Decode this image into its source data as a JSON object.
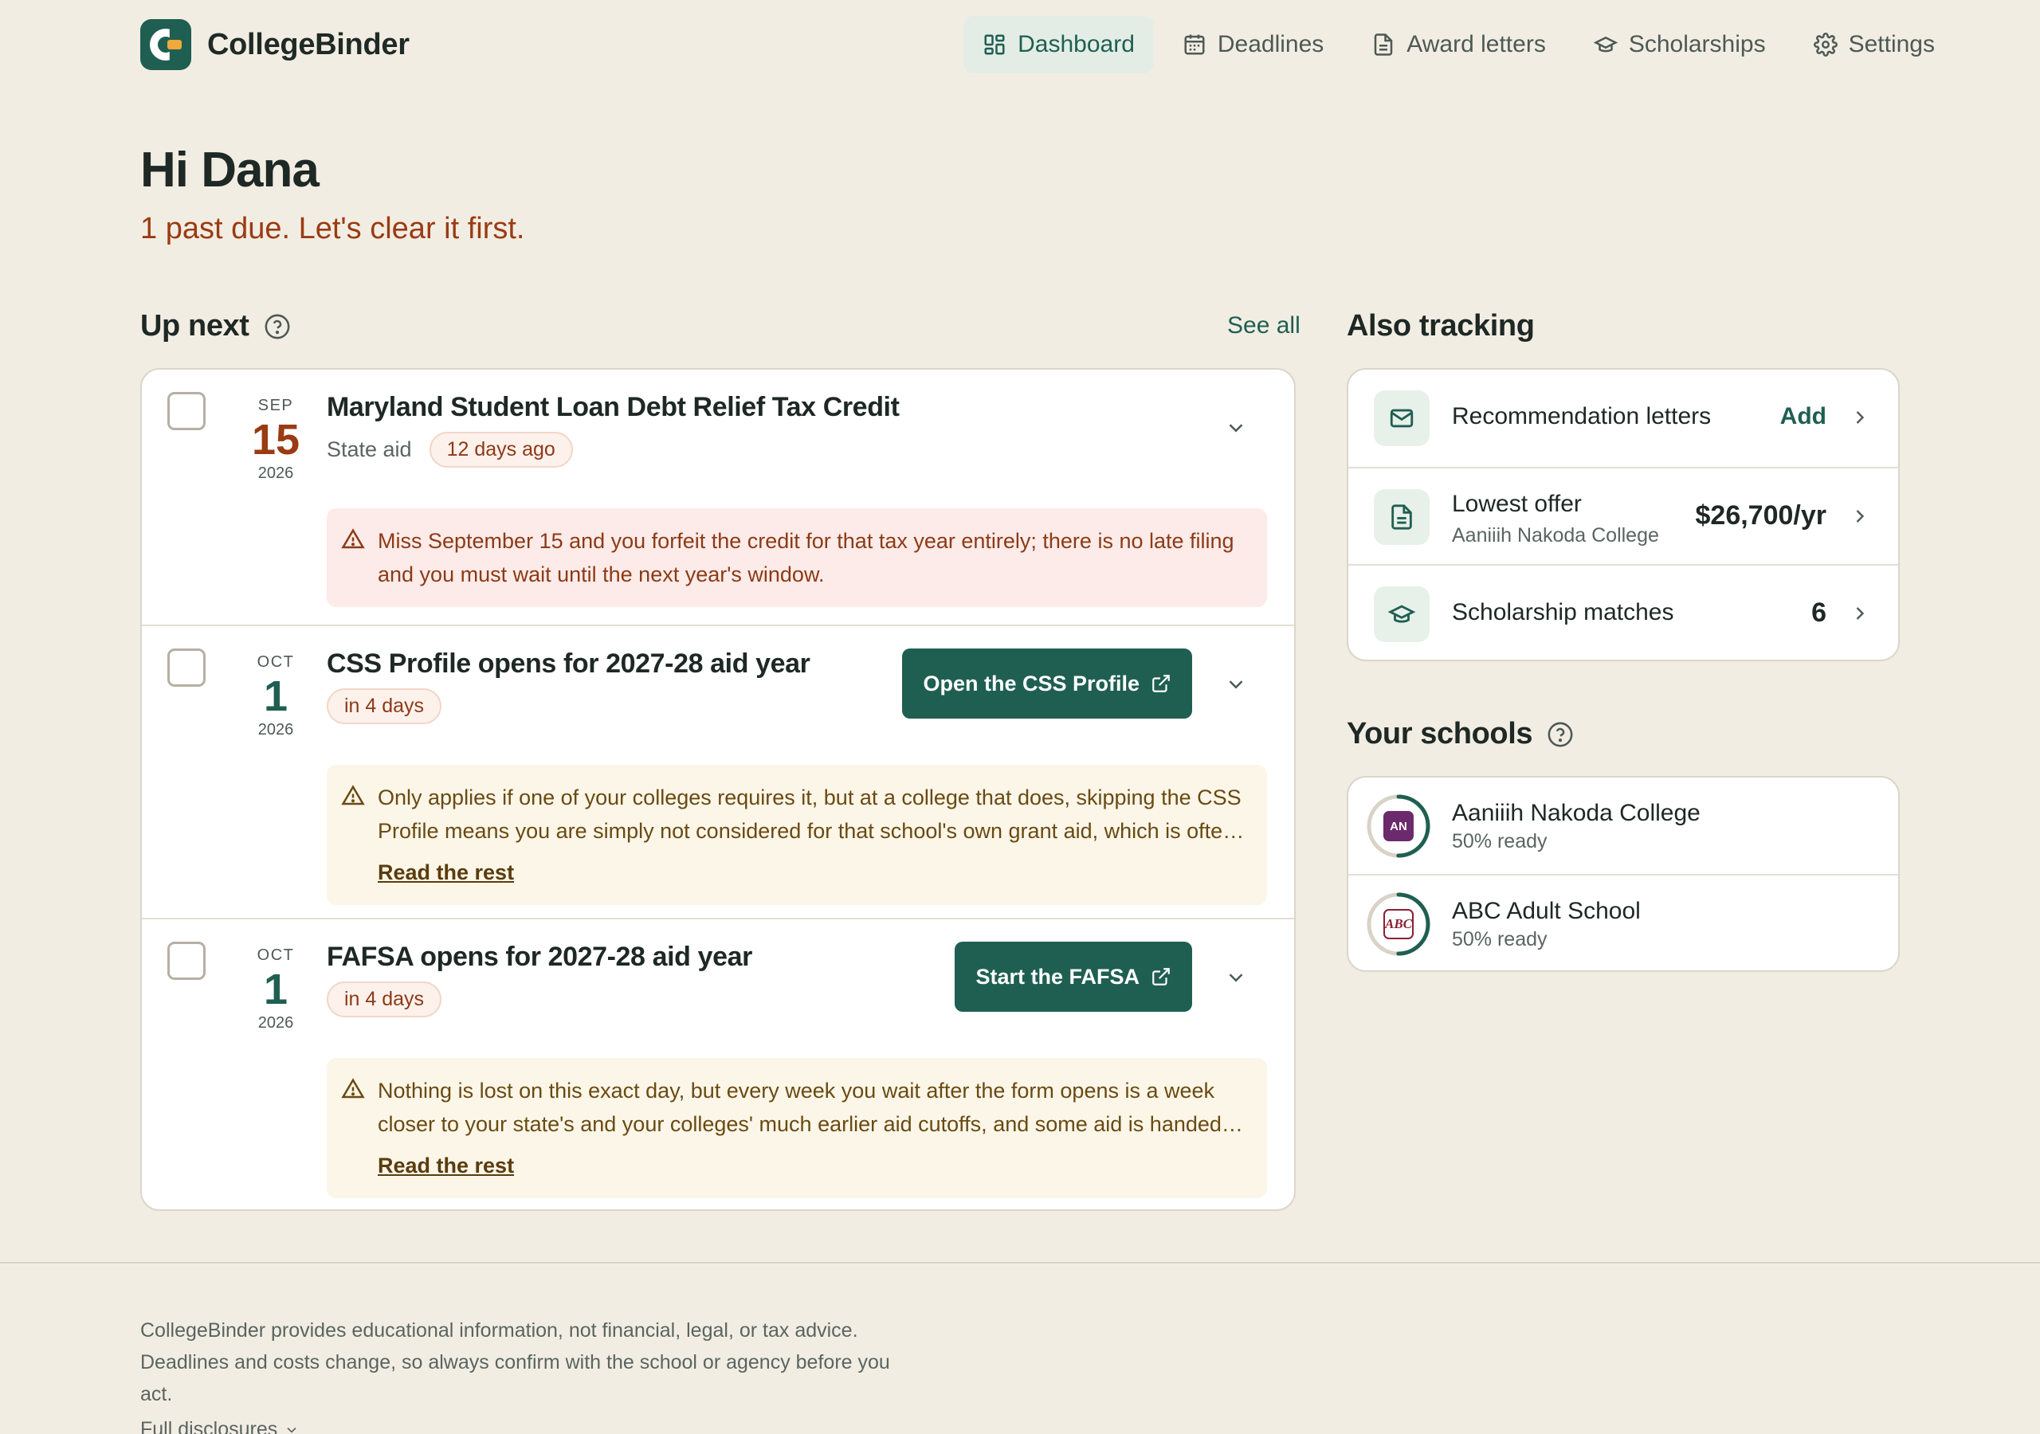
{
  "app": {
    "name": "CollegeBinder"
  },
  "nav": {
    "items": [
      {
        "label": "Dashboard",
        "icon": "dashboard-icon",
        "active": true
      },
      {
        "label": "Deadlines",
        "icon": "calendar-icon",
        "active": false
      },
      {
        "label": "Award letters",
        "icon": "document-icon",
        "active": false
      },
      {
        "label": "Scholarships",
        "icon": "graduation-cap-icon",
        "active": false
      },
      {
        "label": "Settings",
        "icon": "gear-icon",
        "active": false
      }
    ]
  },
  "greeting": {
    "title": "Hi Dana",
    "subtitle": "1 past due. Let's clear it first."
  },
  "up_next": {
    "heading": "Up next",
    "see_all": "See all",
    "items": [
      {
        "month": "SEP",
        "day": "15",
        "year": "2026",
        "title": "Maryland Student Loan Debt Relief Tax Credit",
        "category": "State aid",
        "due": "12 days ago",
        "warning": "Miss September 15 and you forfeit the credit for that tax year entirely; there is no late filing and you must wait until the next year's window.",
        "warning_tone": "red"
      },
      {
        "month": "OCT",
        "day": "1",
        "year": "2026",
        "title": "CSS Profile opens for 2027-28 aid year",
        "due": "in 4 days",
        "cta": "Open the CSS Profile",
        "warning": "Only applies if one of your colleges requires it, but at a college that does, skipping the CSS Profile means you are simply not considered for that school's own grant aid, which is often the largest source of aid.",
        "read_more": "Read the rest",
        "warning_tone": "amber"
      },
      {
        "month": "OCT",
        "day": "1",
        "year": "2026",
        "title": "FAFSA opens for 2027-28 aid year",
        "due": "in 4 days",
        "cta": "Start the FAFSA",
        "warning": "Nothing is lost on this exact day, but every week you wait after the form opens is a week closer to your state's and your colleges' much earlier aid cutoffs, and some aid is handed out first come, first served.",
        "read_more": "Read the rest",
        "warning_tone": "amber"
      }
    ]
  },
  "also_tracking": {
    "heading": "Also tracking",
    "rows": [
      {
        "label": "Recommendation letters",
        "value": "Add",
        "icon": "mail-icon"
      },
      {
        "label": "Lowest offer",
        "sub": "Aaniiih Nakoda College",
        "value": "$26,700/yr",
        "icon": "document-icon"
      },
      {
        "label": "Scholarship matches",
        "value": "6",
        "icon": "graduation-cap-icon"
      }
    ]
  },
  "schools": {
    "heading": "Your schools",
    "items": [
      {
        "name": "Aaniiih Nakoda College",
        "ready": "50% ready",
        "badge": "AN",
        "progress": 0.5
      },
      {
        "name": "ABC Adult School",
        "ready": "50% ready",
        "badge": "ABC",
        "progress": 0.5
      }
    ]
  },
  "footer": {
    "disclaimer": "CollegeBinder provides educational information, not financial, legal, or tax advice. Deadlines and costs change, so always confirm with the school or agency before you act.",
    "disclosures": "Full disclosures"
  },
  "colors": {
    "brand": "#1f5f52",
    "accent": "#f0a93a",
    "past_due": "#9a3b12",
    "background": "#f2ede3"
  }
}
